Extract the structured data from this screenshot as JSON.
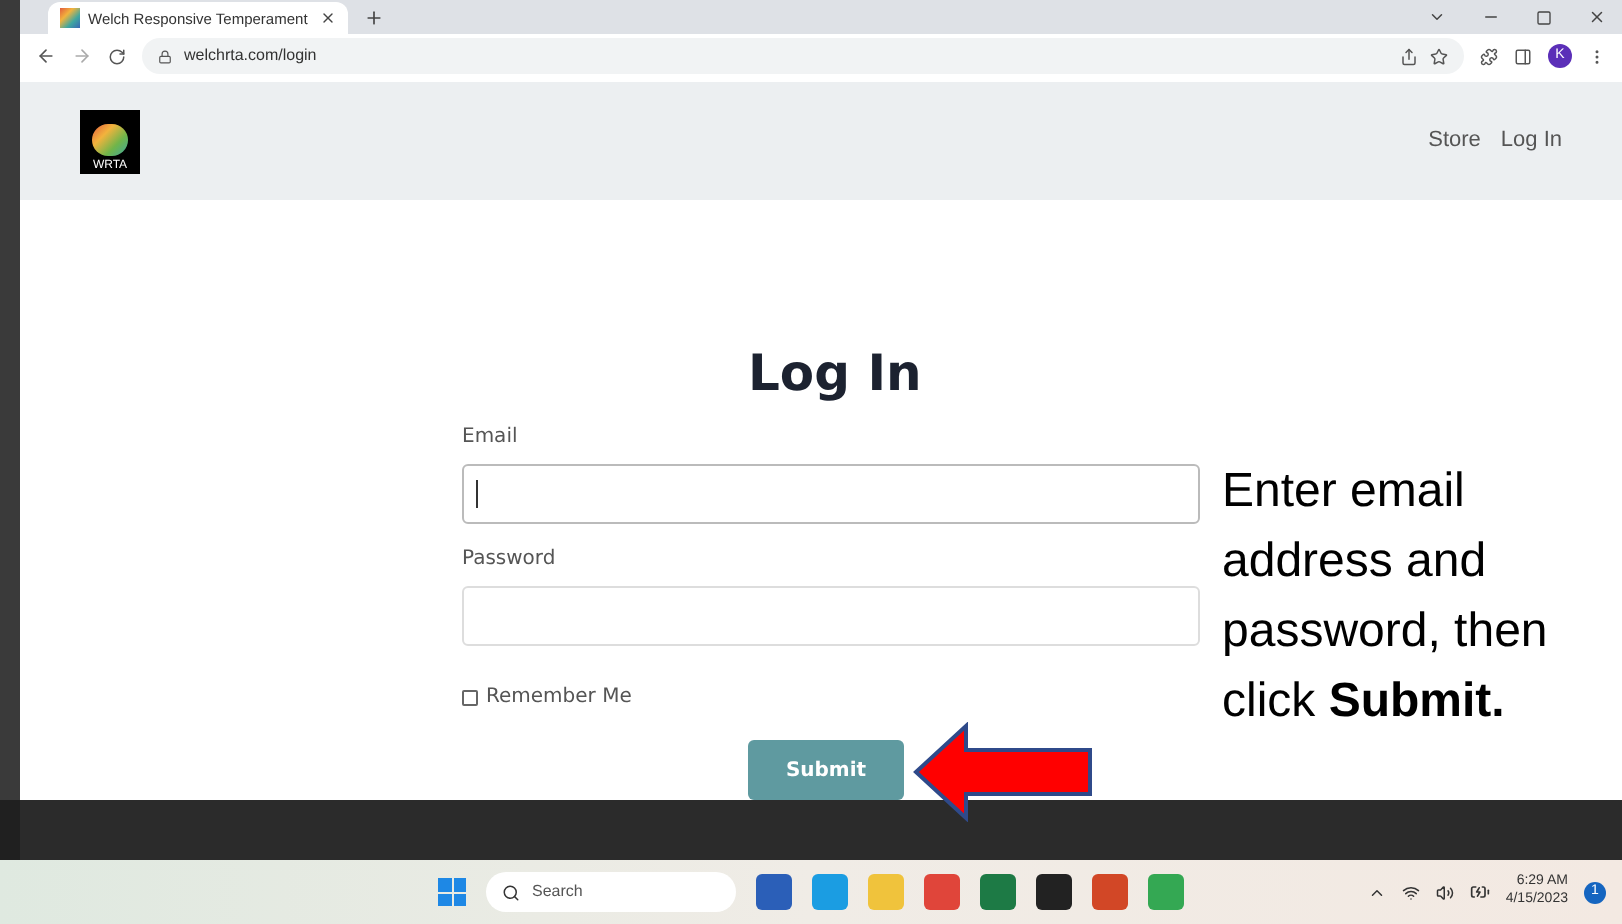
{
  "browser": {
    "tab": {
      "title": "Welch Responsive Temperament",
      "selected": true
    },
    "url": "welchrta.com/login",
    "profile_initial": "K"
  },
  "site": {
    "logo_text": "WRTA",
    "nav": [
      {
        "label": "Store"
      },
      {
        "label": "Log In"
      }
    ]
  },
  "form": {
    "title": "Log In",
    "fields": [
      {
        "label": "Email",
        "focused": true
      },
      {
        "label": "Password",
        "focused": false
      }
    ],
    "remember": {
      "label": "Remember Me",
      "checked": false
    },
    "submit": "Submit"
  },
  "annotation": {
    "text": "Enter email address and password, then click **Submit.**"
  },
  "taskbar": {
    "search_placeholder": "Search",
    "time": "6:29 AM",
    "date": "4/15/2023",
    "notification_count": "1"
  }
}
